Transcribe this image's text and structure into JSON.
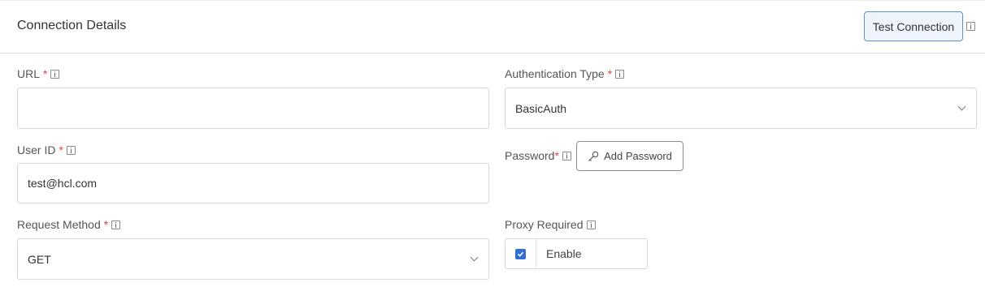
{
  "header": {
    "title": "Connection Details",
    "test_button": "Test Connection"
  },
  "form": {
    "url": {
      "label": "URL",
      "required": "*",
      "value": ""
    },
    "auth_type": {
      "label": "Authentication Type",
      "required": "*",
      "value": "BasicAuth"
    },
    "user_id": {
      "label": "User ID",
      "required": "*",
      "value": "test@hcl.com"
    },
    "password": {
      "label": "Password",
      "required": "*",
      "button": "Add Password"
    },
    "request_method": {
      "label": "Request Method",
      "required": "*",
      "value": "GET"
    },
    "proxy": {
      "label": "Proxy Required",
      "checkbox_label": "Enable",
      "checked": true
    }
  },
  "colors": {
    "accent": "#2f6fd6",
    "required": "#e0434a",
    "border": "#d7d7d7"
  }
}
